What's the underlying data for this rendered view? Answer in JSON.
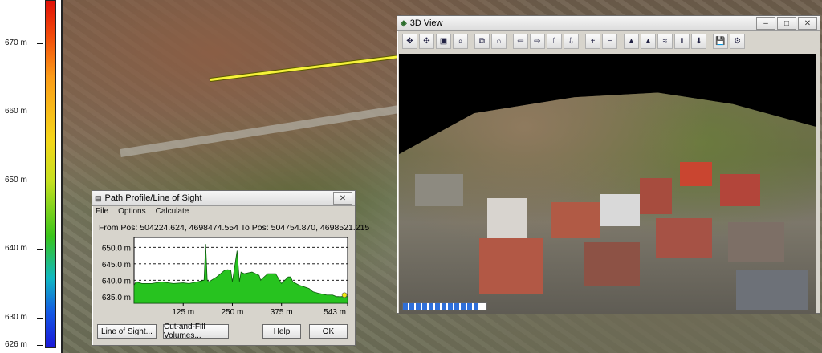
{
  "legend": {
    "ticks": [
      {
        "label": "670 m",
        "value": 670
      },
      {
        "label": "660 m",
        "value": 660
      },
      {
        "label": "650 m",
        "value": 650
      },
      {
        "label": "640 m",
        "value": 640
      },
      {
        "label": "630 m",
        "value": 630
      },
      {
        "label": "626 m",
        "value": 626
      }
    ]
  },
  "view3d": {
    "title": "3D View",
    "controls": {
      "minimize": "–",
      "maximize": "□",
      "close": "✕"
    },
    "toolbar": [
      {
        "name": "move-icon",
        "glyph": "✥"
      },
      {
        "name": "pan-icon",
        "glyph": "✣"
      },
      {
        "name": "layers-icon",
        "glyph": "▣"
      },
      {
        "name": "binoculars-icon",
        "glyph": "⌕"
      },
      {
        "name": "copy-icon",
        "glyph": "⧉"
      },
      {
        "name": "home-icon",
        "glyph": "⌂"
      },
      {
        "name": "arrow-left-icon",
        "glyph": "⇦"
      },
      {
        "name": "arrow-right-icon",
        "glyph": "⇨"
      },
      {
        "name": "arrow-up-icon",
        "glyph": "⇧"
      },
      {
        "name": "arrow-down-icon",
        "glyph": "⇩"
      },
      {
        "name": "zoom-in-icon",
        "glyph": "+"
      },
      {
        "name": "zoom-out-icon",
        "glyph": "−"
      },
      {
        "name": "terrain-icon",
        "glyph": "▲"
      },
      {
        "name": "terrain-plus-icon",
        "glyph": "▲"
      },
      {
        "name": "water-icon",
        "glyph": "≈"
      },
      {
        "name": "water-up-icon",
        "glyph": "⬆"
      },
      {
        "name": "water-down-icon",
        "glyph": "⬇"
      },
      {
        "name": "save-icon",
        "glyph": "💾"
      },
      {
        "name": "settings-icon",
        "glyph": "⚙"
      }
    ],
    "progress": 0.9
  },
  "profile": {
    "title": "Path Profile/Line of Sight",
    "menu": [
      "File",
      "Options",
      "Calculate"
    ],
    "positions": "From Pos: 504224.624, 4698474.554 To Pos: 504754.870, 4698521.215",
    "buttons": {
      "line_of_sight": "Line of Sight...",
      "cut_fill": "Cut-and-Fill Volumes...",
      "help": "Help",
      "ok": "OK"
    }
  },
  "chart_data": {
    "type": "area",
    "xlabel": "",
    "ylabel": "",
    "xlim": [
      0,
      543
    ],
    "ylim": [
      633,
      653
    ],
    "yticks": [
      {
        "label": "650.0 m",
        "value": 650
      },
      {
        "label": "645.0 m",
        "value": 645
      },
      {
        "label": "640.0 m",
        "value": 640
      },
      {
        "label": "635.0 m",
        "value": 635
      }
    ],
    "xticks": [
      {
        "label": "125 m",
        "value": 125
      },
      {
        "label": "250 m",
        "value": 250
      },
      {
        "label": "375 m",
        "value": 375
      },
      {
        "label": "543 m",
        "value": 543
      }
    ],
    "grid": true,
    "colors": {
      "fill": "#27c31f",
      "line": "#0d5a0d"
    },
    "x": [
      0,
      5,
      20,
      45,
      70,
      100,
      125,
      140,
      160,
      178,
      182,
      186,
      190,
      210,
      230,
      238,
      246,
      250,
      262,
      268,
      272,
      280,
      300,
      318,
      322,
      326,
      340,
      360,
      375,
      392,
      398,
      404,
      420,
      445,
      455,
      470,
      490,
      505,
      515,
      525,
      535,
      543
    ],
    "y": [
      638.5,
      639.5,
      639.0,
      639.0,
      639.5,
      639.0,
      639.2,
      639.0,
      639.5,
      640.0,
      651.0,
      640.0,
      639.5,
      641.0,
      643.0,
      643.2,
      643.0,
      639.5,
      649.0,
      639.5,
      642.5,
      642.0,
      642.5,
      641.5,
      640.0,
      640.5,
      642.0,
      642.0,
      639.0,
      641.0,
      641.0,
      639.5,
      638.5,
      637.5,
      636.5,
      636.0,
      635.5,
      635.5,
      635.0,
      635.0,
      635.0,
      635.0
    ],
    "marker": {
      "x": 535,
      "y": 635.5,
      "color": "#f1ea10"
    }
  }
}
